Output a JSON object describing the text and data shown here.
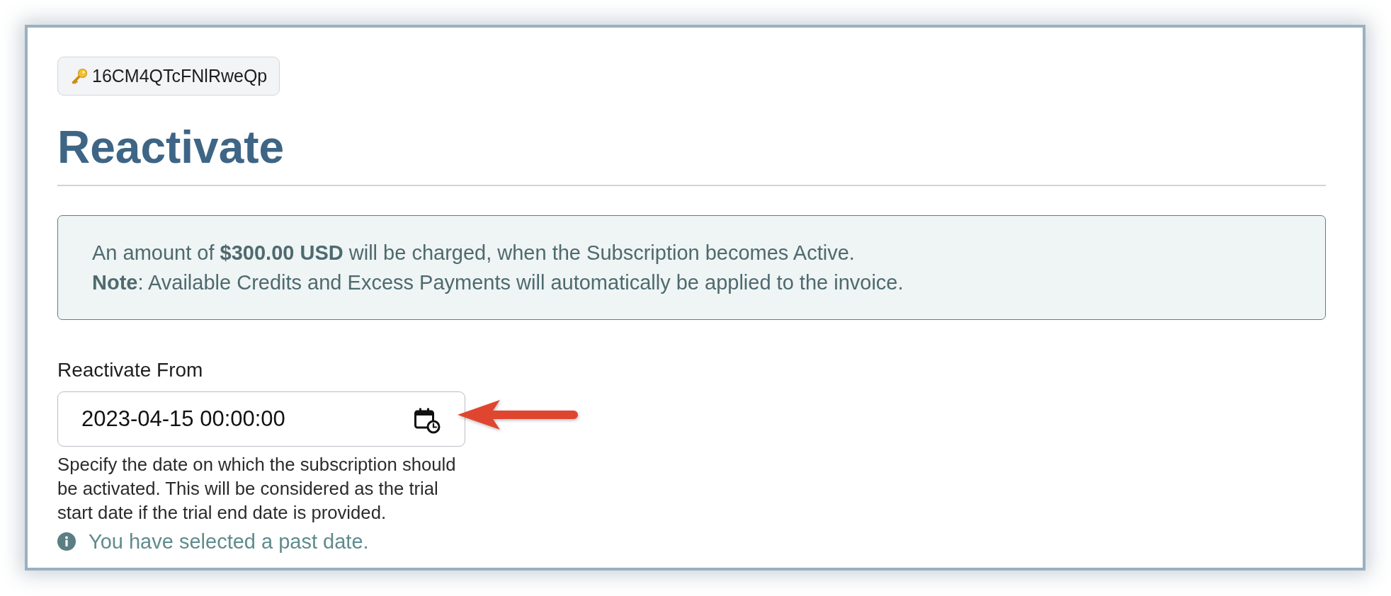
{
  "record_badge": {
    "text": "16CM4QTcFNlRweQp"
  },
  "title": "Reactivate",
  "notice": {
    "lines": [
      "An amount of **$300.00 USD** will be charged, when the Subscription becomes Active.",
      "**Note**: Available Credits and Excess Payments will automatically be applied to the invoice."
    ]
  },
  "reactivate_from": {
    "label": "Reactivate From",
    "value": "2023-04-15 00:00:00",
    "help": "Specify the date on which the subscription should be activated. This will be considered as the trial start date if the trial end date is provided.",
    "warning": "You have selected a past date."
  }
}
